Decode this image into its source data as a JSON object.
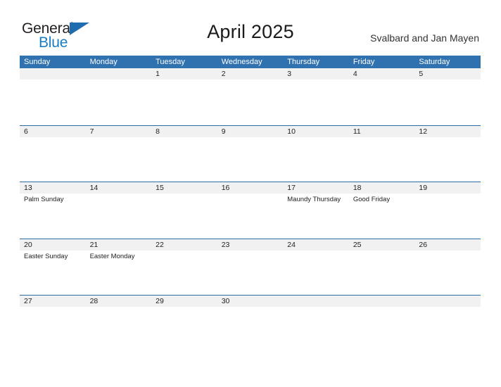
{
  "brand": {
    "logo_word_one": "General",
    "logo_word_two": "Blue",
    "logo_triangle_icon": "triangle-icon",
    "primary_color": "#3071b0",
    "accent_color": "#1a7dc4"
  },
  "header": {
    "title": "April 2025",
    "region": "Svalbard and Jan Mayen"
  },
  "calendar": {
    "month": "April",
    "year": "2025",
    "weekdays": [
      "Sunday",
      "Monday",
      "Tuesday",
      "Wednesday",
      "Thursday",
      "Friday",
      "Saturday"
    ],
    "weeks": [
      [
        {
          "date": "",
          "events": []
        },
        {
          "date": "",
          "events": []
        },
        {
          "date": "1",
          "events": []
        },
        {
          "date": "2",
          "events": []
        },
        {
          "date": "3",
          "events": []
        },
        {
          "date": "4",
          "events": []
        },
        {
          "date": "5",
          "events": []
        }
      ],
      [
        {
          "date": "6",
          "events": []
        },
        {
          "date": "7",
          "events": []
        },
        {
          "date": "8",
          "events": []
        },
        {
          "date": "9",
          "events": []
        },
        {
          "date": "10",
          "events": []
        },
        {
          "date": "11",
          "events": []
        },
        {
          "date": "12",
          "events": []
        }
      ],
      [
        {
          "date": "13",
          "events": [
            "Palm Sunday"
          ]
        },
        {
          "date": "14",
          "events": []
        },
        {
          "date": "15",
          "events": []
        },
        {
          "date": "16",
          "events": []
        },
        {
          "date": "17",
          "events": [
            "Maundy Thursday"
          ]
        },
        {
          "date": "18",
          "events": [
            "Good Friday"
          ]
        },
        {
          "date": "19",
          "events": []
        }
      ],
      [
        {
          "date": "20",
          "events": [
            "Easter Sunday"
          ]
        },
        {
          "date": "21",
          "events": [
            "Easter Monday"
          ]
        },
        {
          "date": "22",
          "events": []
        },
        {
          "date": "23",
          "events": []
        },
        {
          "date": "24",
          "events": []
        },
        {
          "date": "25",
          "events": []
        },
        {
          "date": "26",
          "events": []
        }
      ],
      [
        {
          "date": "27",
          "events": []
        },
        {
          "date": "28",
          "events": []
        },
        {
          "date": "29",
          "events": []
        },
        {
          "date": "30",
          "events": []
        },
        {
          "date": "",
          "events": []
        },
        {
          "date": "",
          "events": []
        },
        {
          "date": "",
          "events": []
        }
      ]
    ]
  }
}
